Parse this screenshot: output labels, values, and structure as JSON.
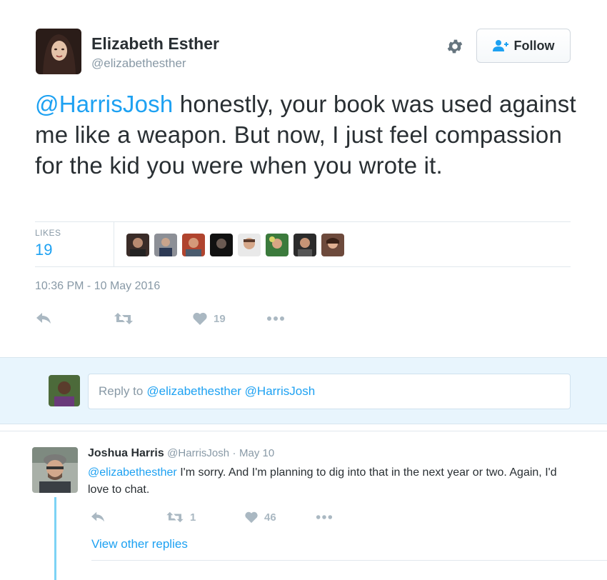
{
  "tweet": {
    "author_name": "Elizabeth Esther",
    "author_handle": "@elizabethesther",
    "follow_label": "Follow",
    "text_mention": "@HarrisJosh",
    "text_body": " honestly, your book was used against me like a weapon. But now, I just feel compassion for the kid you were when you wrote it.",
    "likes_label": "LIKES",
    "likes_count": "19",
    "timestamp": "10:36 PM - 10 May 2016",
    "action_like_count": "19"
  },
  "reply_box": {
    "prefix": "Reply to",
    "mentions": "@elizabethesther @HarrisJosh"
  },
  "reply_tweet": {
    "author_name": "Joshua Harris",
    "author_handle": "@HarrisJosh",
    "separator": "·",
    "date": "May 10",
    "mention": "@elizabethesther",
    "body": " I'm sorry. And I'm planning to dig into that in the next year or two. Again, I'd love to chat.",
    "retweet_count": "1",
    "like_count": "46",
    "view_other_replies": "View other replies"
  },
  "colors": {
    "accent": "#1da1f2",
    "muted": "#8899a6",
    "thread_line": "#7dd3f5",
    "reply_bg": "#e8f5fd"
  }
}
